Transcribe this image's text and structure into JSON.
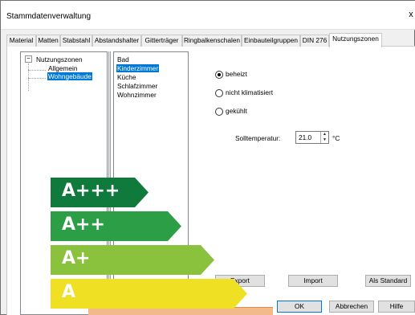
{
  "window": {
    "title": "Stammdatenverwaltung",
    "close_glyph": "x"
  },
  "tabs": [
    {
      "label": "Material"
    },
    {
      "label": "Matten"
    },
    {
      "label": "Stabstahl"
    },
    {
      "label": "Abstandshalter"
    },
    {
      "label": "Gitterträger"
    },
    {
      "label": "Ringbalkenschalen"
    },
    {
      "label": "Einbauteilgruppen"
    },
    {
      "label": "DIN 276"
    },
    {
      "label": "Nutzungszonen",
      "active": true
    }
  ],
  "tree": {
    "root": {
      "label": "Nutzungszonen",
      "toggle": "−"
    },
    "children": [
      {
        "label": "Allgemein"
      },
      {
        "label": "Wohngebäude",
        "selected": true
      }
    ]
  },
  "rooms": [
    {
      "label": "Bad"
    },
    {
      "label": "Kinderzimmer",
      "selected": true
    },
    {
      "label": "Küche"
    },
    {
      "label": "Schlafzimmer"
    },
    {
      "label": "Wohnzimmer"
    }
  ],
  "options": [
    {
      "label": "beheizt",
      "checked": true
    },
    {
      "label": "nicht klimatisiert",
      "checked": false
    },
    {
      "label": "gekühlt",
      "checked": false
    }
  ],
  "target_temperature": {
    "label": "Solltemperatur:",
    "value": "21.0",
    "unit": "°C"
  },
  "buttons": {
    "export": "Export",
    "import": "Import",
    "set_default": "Als Standard",
    "ok": "OK",
    "cancel": "Abbrechen",
    "help": "Hilfe"
  },
  "energy_labels": [
    {
      "text": "A+++",
      "color": "#0f7a3c"
    },
    {
      "text": "A++",
      "color": "#2c9e46"
    },
    {
      "text": "A+",
      "color": "#8ac13d"
    },
    {
      "text": "A",
      "color": "#f0e024"
    }
  ]
}
